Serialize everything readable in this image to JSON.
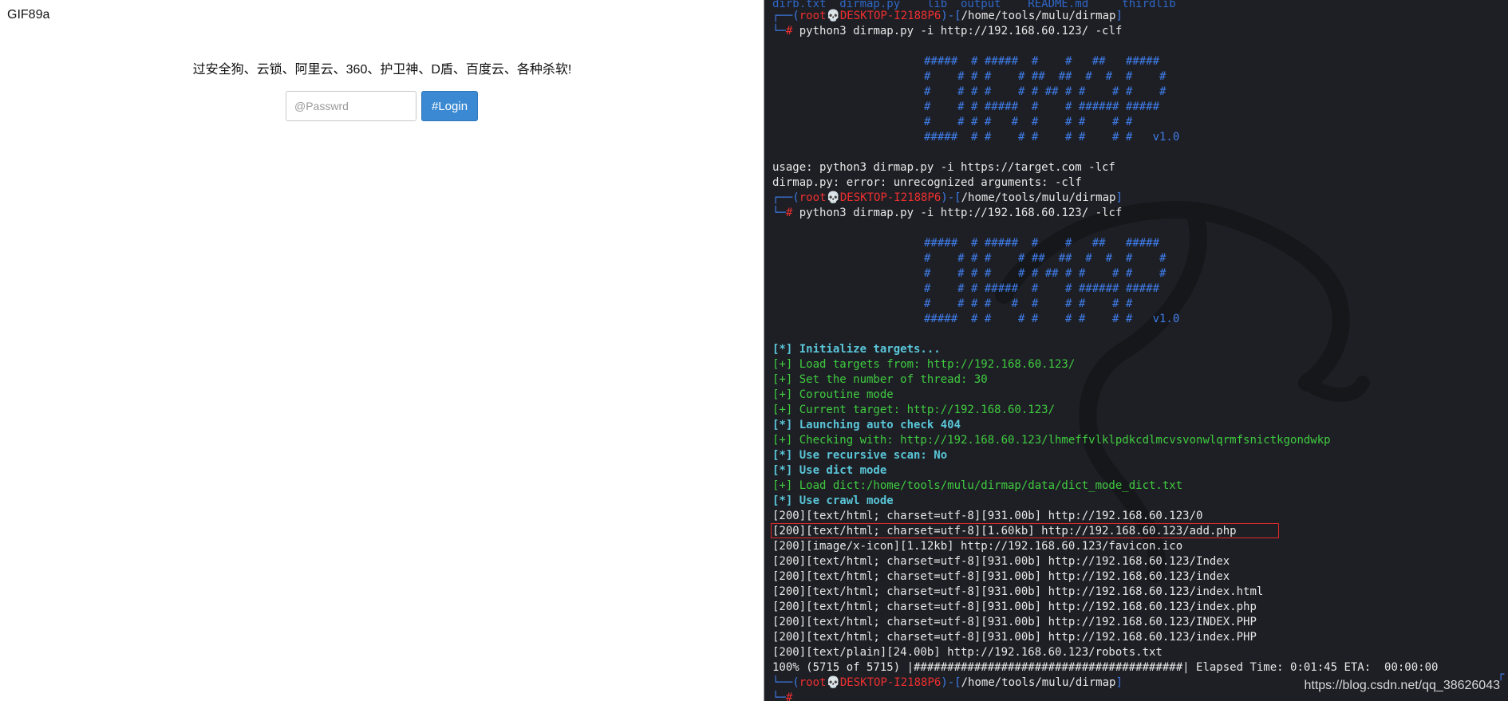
{
  "browser": {
    "header_text": "GIF89a",
    "warning_text": "过安全狗、云锁、阿里云、360、护卫神、D盾、百度云、各种杀软!",
    "password_placeholder": "@Passwrd",
    "login_label": "#Login"
  },
  "terminal": {
    "top_line": "dirb.txt  dirmap.py    lib  output    README.md     thirdlib",
    "prompt": {
      "user": "root",
      "skull": "💀",
      "host": "DESKTOP-I2188P6",
      "path": "/home/tools/mulu/dirmap"
    },
    "command": "python3 dirmap.py -i http://192.168.60.123/ -clf",
    "command2": "python3 dirmap.py -i http://192.168.60.123/ -lcf",
    "banner": [
      "#####  # #####  #    #   ##   #####",
      "#    # # #    # ##  ##  #  #  #    #",
      "#    # # #    # # ## # #    # #    #",
      "#    # # #####  #    # ###### #####",
      "#    # # #   #  #    # #    # #",
      "#####  # #    # #    # #    # #   v1.0"
    ],
    "usage": "usage: python3 dirmap.py -i https://target.com -lcf",
    "error": "dirmap.py: error: unrecognized arguments: -clf",
    "log": [
      {
        "text": "[*] Initialize targets...",
        "cls": "cyan"
      },
      {
        "text": "[+] Load targets from: http://192.168.60.123/",
        "cls": "green"
      },
      {
        "text": "[+] Set the number of thread: 30",
        "cls": "green"
      },
      {
        "text": "[+] Coroutine mode",
        "cls": "green"
      },
      {
        "text": "[+] Current target: http://192.168.60.123/",
        "cls": "green"
      },
      {
        "text": "[*] Launching auto check 404",
        "cls": "cyan"
      },
      {
        "text": "[+] Checking with: http://192.168.60.123/lhmeffvlklpdkcdlmcvsvonwlqrmfsnictkgondwkp",
        "cls": "green"
      },
      {
        "text": "[*] Use recursive scan: No",
        "cls": "cyan"
      },
      {
        "text": "[*] Use dict mode",
        "cls": "cyan"
      },
      {
        "text": "[+] Load dict:/home/tools/mulu/dirmap/data/dict_mode_dict.txt",
        "cls": "green"
      },
      {
        "text": "[*] Use crawl mode",
        "cls": "cyan"
      }
    ],
    "results": [
      "[200][text/html; charset=utf-8][931.00b] http://192.168.60.123/0",
      "[200][text/html; charset=utf-8][1.60kb] http://192.168.60.123/add.php",
      "[200][image/x-icon][1.12kb] http://192.168.60.123/favicon.ico",
      "[200][text/html; charset=utf-8][931.00b] http://192.168.60.123/Index",
      "[200][text/html; charset=utf-8][931.00b] http://192.168.60.123/index",
      "[200][text/html; charset=utf-8][931.00b] http://192.168.60.123/index.html",
      "[200][text/html; charset=utf-8][931.00b] http://192.168.60.123/index.php",
      "[200][text/html; charset=utf-8][931.00b] http://192.168.60.123/INDEX.PHP",
      "[200][text/html; charset=utf-8][931.00b] http://192.168.60.123/index.PHP",
      "[200][text/plain][24.00b] http://192.168.60.123/robots.txt"
    ],
    "progress": "100% (5715 of 5715) |########################################| Elapsed Time: 0:01:45 ETA:  00:00:00",
    "highlighted_result": "http://192.168.60.123/add.php"
  },
  "watermark": "https://blog.csdn.net/qq_38626043",
  "colors": {
    "terminal_bg": "#1e1f25",
    "prompt_blue": "#3e7ce8",
    "prompt_red": "#ef2f2f",
    "log_green": "#3fcc3f",
    "log_cyan": "#59c6d8",
    "login_button": "#3a89d2"
  }
}
